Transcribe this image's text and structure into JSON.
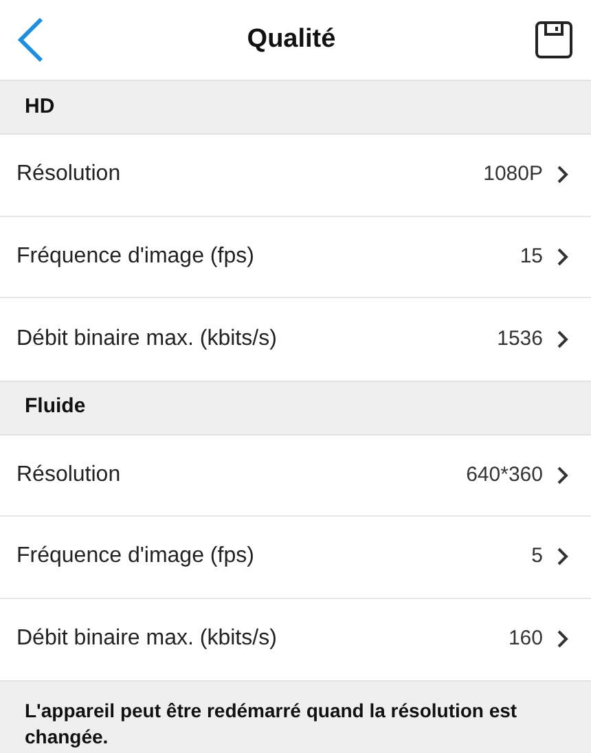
{
  "header": {
    "title": "Qualité"
  },
  "sections": [
    {
      "title": "HD",
      "rows": [
        {
          "label": "Résolution",
          "value": "1080P"
        },
        {
          "label": "Fréquence d'image (fps)",
          "value": "15"
        },
        {
          "label": "Débit binaire max. (kbits/s)",
          "value": "1536"
        }
      ]
    },
    {
      "title": "Fluide",
      "rows": [
        {
          "label": "Résolution",
          "value": "640*360"
        },
        {
          "label": "Fréquence d'image (fps)",
          "value": "5"
        },
        {
          "label": "Débit binaire max. (kbits/s)",
          "value": "160"
        }
      ]
    }
  ],
  "footer": "L'appareil peut être redémarré quand la résolution est changée."
}
